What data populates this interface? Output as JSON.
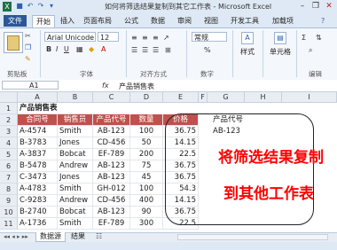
{
  "window": {
    "title": "如何将筛选结果复制到其它工作表 - Microsoft Excel"
  },
  "ribbon_tabs": [
    "文件",
    "开始",
    "插入",
    "页面布局",
    "公式",
    "数据",
    "审阅",
    "视图",
    "开发工具",
    "加载项"
  ],
  "ribbon": {
    "font_name": "Arial Unicode M",
    "font_size": "12",
    "group_labels": [
      "剪贴板",
      "字体",
      "对齐方式",
      "数字",
      "单元格",
      "编辑"
    ],
    "number_format": "%",
    "style_label": "样式",
    "cells_label": "单元格",
    "wrap_label": "常规"
  },
  "formula_bar": {
    "name_box": "A1",
    "fx": "fx",
    "value": "产品销售表"
  },
  "columns": [
    "A",
    "B",
    "C",
    "D",
    "E",
    "F",
    "G",
    "H",
    "I"
  ],
  "rows": [
    "1",
    "2",
    "3",
    "4",
    "5",
    "6",
    "7",
    "8",
    "9",
    "10",
    "11"
  ],
  "sheet": {
    "title": "产品销售表",
    "headers": [
      "合同号",
      "销售员",
      "产品代号",
      "数量",
      "价格"
    ],
    "data": [
      [
        "A-4574",
        "Smith",
        "AB-123",
        "100",
        "36.75"
      ],
      [
        "B-3783",
        "Jones",
        "CD-456",
        "50",
        "14.15"
      ],
      [
        "A-3837",
        "Bobcat",
        "EF-789",
        "200",
        "22.5"
      ],
      [
        "B-5478",
        "Andrew",
        "AB-123",
        "75",
        "36.75"
      ],
      [
        "C-3473",
        "Jones",
        "AB-123",
        "45",
        "36.75"
      ],
      [
        "A-4783",
        "Smith",
        "GH-012",
        "100",
        "54.3"
      ],
      [
        "C-9283",
        "Andrew",
        "CD-456",
        "400",
        "14.15"
      ],
      [
        "B-2740",
        "Bobcat",
        "AB-123",
        "90",
        "36.75"
      ],
      [
        "A-1736",
        "Smith",
        "EF-789",
        "300",
        "22.5"
      ]
    ],
    "criteria_header": "产品代号",
    "criteria_value": "AB-123"
  },
  "annotation": {
    "line1": "将筛选结果复制",
    "line2": "到其他工作表",
    "color": "#ff0000"
  },
  "sheet_tabs": [
    "数据源",
    "结果"
  ],
  "active_sheet": "数据源"
}
